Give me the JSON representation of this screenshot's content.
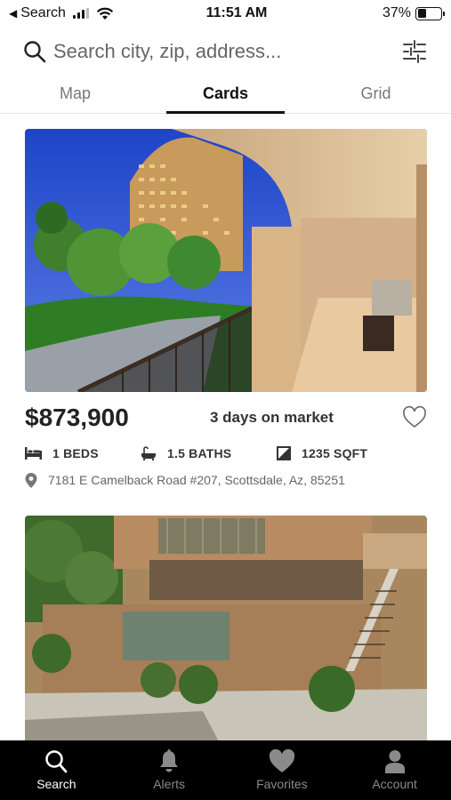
{
  "status_bar": {
    "back_app": "Search",
    "time": "11:51 AM",
    "battery_percent": "37%",
    "battery_level": 0.37
  },
  "search": {
    "placeholder": "Search city, zip, address..."
  },
  "tabs": [
    {
      "label": "Map",
      "active": false
    },
    {
      "label": "Cards",
      "active": true
    },
    {
      "label": "Grid",
      "active": false
    }
  ],
  "listings": [
    {
      "price": "$873,900",
      "days_on_market": "3 days on market",
      "beds": "1 BEDS",
      "baths": "1.5 BATHS",
      "sqft": "1235 SQFT",
      "address": "7181 E Camelback Road #207, Scottsdale, Az, 85251"
    },
    {}
  ],
  "bottom_nav": [
    {
      "label": "Search",
      "icon": "search-icon",
      "active": true
    },
    {
      "label": "Alerts",
      "icon": "bell-icon",
      "active": false
    },
    {
      "label": "Favorites",
      "icon": "heart-icon",
      "active": false
    },
    {
      "label": "Account",
      "icon": "person-icon",
      "active": false
    }
  ],
  "colors": {
    "accent": "#111111",
    "nav_background": "#000000",
    "nav_inactive": "#8a8a8a"
  }
}
